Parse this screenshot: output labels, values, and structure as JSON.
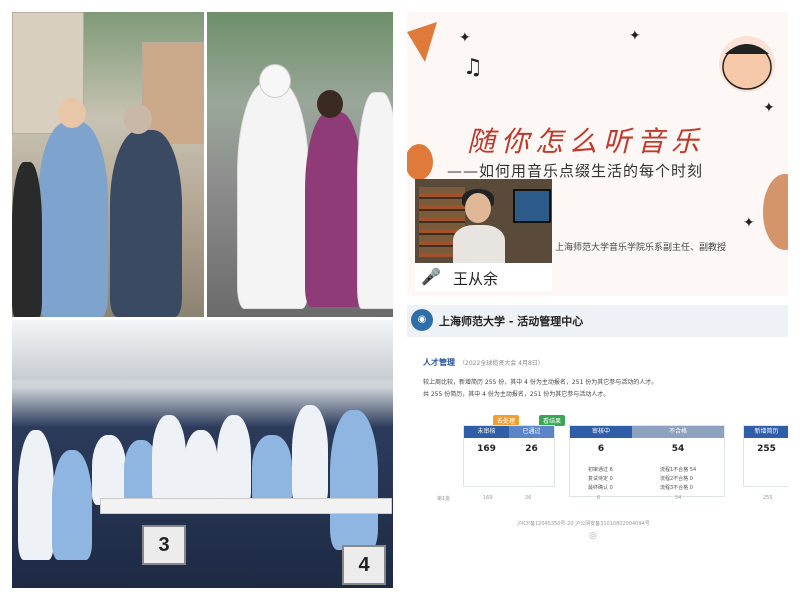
{
  "photo3": {
    "chair_left": "3",
    "chair_right": "4"
  },
  "lecture": {
    "title": "随你怎么听音乐",
    "subtitle": "——如何用音乐点缀生活的每个时刻",
    "affiliation": "上海师范大学音乐学院乐系副主任、副教授",
    "speaker_name": "王从余"
  },
  "activity": {
    "header_title": "上海师范大学 - 活动管理中心",
    "section_title": "人才管理",
    "section_note": "（2022全球揽贤大会 4月8日）",
    "line1": "较上周比较，新增简历 255 份，其中 4 份为主动报名，251 份为其它参与活动的人才。",
    "line2": "共 255 份简历，其中 4 份为主动报名，251 份为其它参与活动人才。",
    "tag_pending": "去处理",
    "tag_view": "看结果",
    "cards": [
      {
        "headers": [
          "未审核",
          "已通过"
        ],
        "values": [
          "169",
          "26"
        ]
      },
      {
        "headers": [
          "审核中",
          "不合格"
        ],
        "values": [
          "6",
          "54"
        ]
      },
      {
        "headers": [
          "新增简历"
        ],
        "values": [
          "255"
        ]
      }
    ],
    "mini_rows": [
      {
        "label": "初审通过",
        "value": "6"
      },
      {
        "label": "复试待定",
        "value": "0"
      },
      {
        "label": "最终确认",
        "value": "0"
      }
    ],
    "mini_rows_right": [
      {
        "label": "流程1不合格",
        "value": "54"
      },
      {
        "label": "流程2不合格",
        "value": "0"
      },
      {
        "label": "流程3不合格",
        "value": "0"
      }
    ],
    "bottom_row": [
      "第1批",
      "169",
      "26",
      "6",
      "54",
      "255"
    ],
    "footer": "沪ICP备12045350号-20 沪公网安备31010802004094号"
  }
}
